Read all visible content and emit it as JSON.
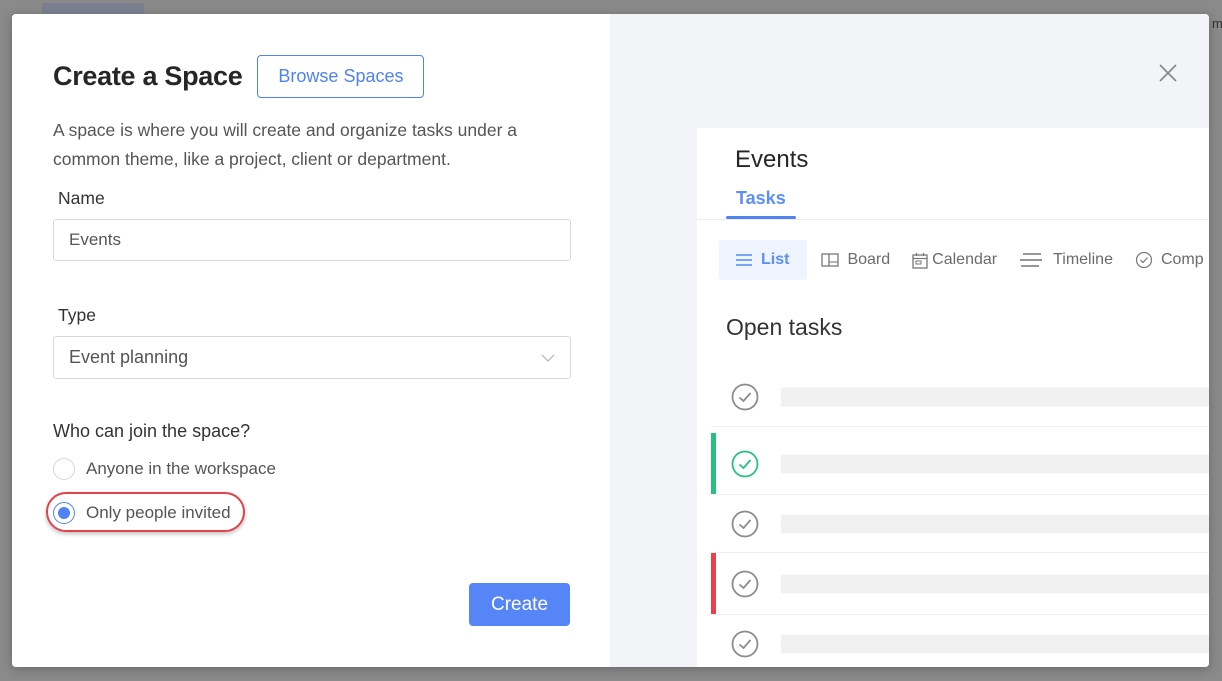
{
  "background": {
    "partial_text": "m"
  },
  "modal": {
    "title": "Create a Space",
    "browse_button": "Browse Spaces",
    "description": "A space is where you will create and organize tasks under a common theme, like a project, client or department.",
    "name_field": {
      "label": "Name",
      "value": "Events"
    },
    "type_field": {
      "label": "Type",
      "selected": "Event planning"
    },
    "access": {
      "label": "Who can join the space?",
      "options": [
        {
          "label": "Anyone in the workspace",
          "checked": false
        },
        {
          "label": "Only people invited",
          "checked": true
        }
      ]
    },
    "create_button": "Create",
    "colors": {
      "accent": "#4f82f2",
      "highlight": "#e0434b"
    }
  },
  "preview": {
    "title": "Events",
    "tab": "Tasks",
    "views": [
      {
        "label": "List",
        "icon": "list-icon",
        "active": true
      },
      {
        "label": "Board",
        "icon": "board-icon",
        "active": false
      },
      {
        "label": "Calendar",
        "icon": "calendar-icon",
        "active": false
      },
      {
        "label": "Timeline",
        "icon": "timeline-icon",
        "active": false
      },
      {
        "label": "Comp",
        "icon": "check-circle-icon",
        "active": false
      }
    ],
    "section_title": "Open tasks",
    "tasks": [
      {
        "status_color": "",
        "check_color": "#8c8c8c"
      },
      {
        "status_color": "#25c27f",
        "check_color": "#25c27f"
      },
      {
        "status_color": "",
        "check_color": "#8c8c8c"
      },
      {
        "status_color": "#e8414a",
        "check_color": "#8c8c8c"
      },
      {
        "status_color": "",
        "check_color": "#8c8c8c"
      }
    ]
  }
}
